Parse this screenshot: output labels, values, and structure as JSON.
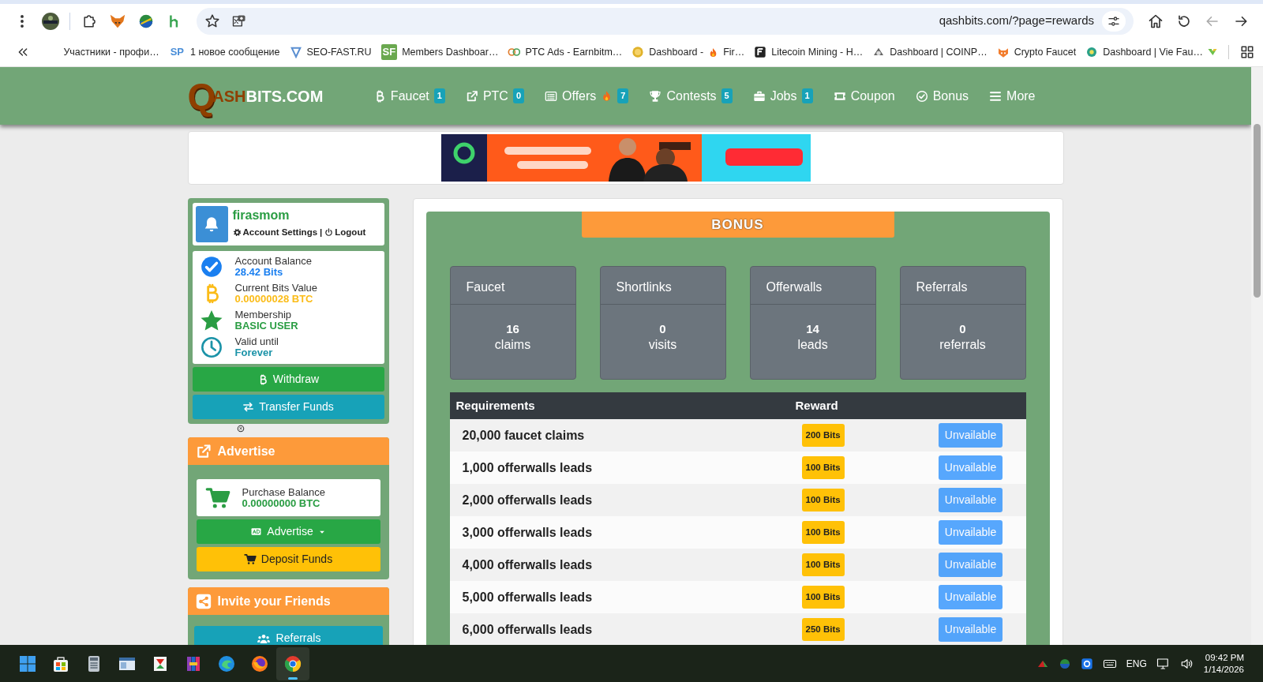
{
  "browser": {
    "address": "qashbits.com/?page=rewards",
    "bookmarks": [
      {
        "label": "Участники - профи…"
      },
      {
        "badge": "SP",
        "label": "1 новое сообщение"
      },
      {
        "label": "SEO-FAST.RU"
      },
      {
        "badge": "SF",
        "label": "Members Dashboar…"
      },
      {
        "label": "PTC Ads - Earnbitm…"
      },
      {
        "label": "Dashboard -",
        "label_after_fire": "Fir…"
      },
      {
        "label": "Litecoin Mining - H…"
      },
      {
        "label": "Dashboard | COINP…"
      },
      {
        "label": "Crypto Faucet"
      },
      {
        "label": "Dashboard | Vie Fau…"
      }
    ]
  },
  "site": {
    "logo": {
      "mark": "Q",
      "accent": "ASH",
      "rest": "BITS.COM"
    },
    "nav": [
      {
        "label": "Faucet",
        "count": "1",
        "hot": false
      },
      {
        "label": "PTC",
        "count": "0",
        "hot": false
      },
      {
        "label": "Offers",
        "count": "7",
        "hot": true
      },
      {
        "label": "Contests",
        "count": "5",
        "hot": false
      },
      {
        "label": "Jobs",
        "count": "1",
        "hot": false
      },
      {
        "label": "Coupon",
        "hot": false
      },
      {
        "label": "Bonus",
        "hot": false
      },
      {
        "label": "More",
        "hot": false
      }
    ]
  },
  "account": {
    "username": "firasmom",
    "links": [
      "Account Settings",
      "Logout"
    ],
    "separator": "|",
    "stats": [
      {
        "label": "Account Balance",
        "value": "28.42 Bits",
        "color": "#1a7ff0"
      },
      {
        "label": "Current Bits Value",
        "value": "0.00000028 BTC",
        "color": "#fbbc18"
      },
      {
        "label": "Membership",
        "value": "BASIC USER",
        "color": "#2a9d43"
      },
      {
        "label": "Valid until",
        "value": "Forever",
        "color": "#1b93a8"
      }
    ],
    "buttons": [
      "Withdraw",
      "Transfer Funds"
    ]
  },
  "advertise": {
    "title": "Advertise",
    "balance_label": "Purchase Balance",
    "balance_value": "0.00000000 BTC",
    "buttons": [
      "Advertise",
      "Deposit Funds"
    ]
  },
  "invite": {
    "title": "Invite your Friends",
    "buttons": [
      "Referrals"
    ]
  },
  "bonus": {
    "title": "BONUS",
    "cards": [
      {
        "title": "Faucet",
        "value": "16",
        "unit": "claims"
      },
      {
        "title": "Shortlinks",
        "value": "0",
        "unit": "visits"
      },
      {
        "title": "Offerwalls",
        "value": "14",
        "unit": "leads"
      },
      {
        "title": "Referrals",
        "value": "0",
        "unit": "referrals"
      }
    ],
    "table": {
      "columns": [
        "Requirements",
        "Reward"
      ],
      "rows": [
        {
          "requirement": "20,000 faucet claims",
          "reward": "200 Bits",
          "action": "Unvailable",
          "disabled": true
        },
        {
          "requirement": "1,000 offerwalls leads",
          "reward": "100 Bits",
          "action": "Unvailable",
          "disabled": true
        },
        {
          "requirement": "2,000 offerwalls leads",
          "reward": "100 Bits",
          "action": "Unvailable",
          "disabled": true
        },
        {
          "requirement": "3,000 offerwalls leads",
          "reward": "100 Bits",
          "action": "Unvailable",
          "disabled": true
        },
        {
          "requirement": "4,000 offerwalls leads",
          "reward": "100 Bits",
          "action": "Unvailable",
          "disabled": true
        },
        {
          "requirement": "5,000 offerwalls leads",
          "reward": "100 Bits",
          "action": "Unvailable",
          "disabled": true
        },
        {
          "requirement": "6,000 offerwalls leads",
          "reward": "250 Bits",
          "action": "Unvailable",
          "disabled": true
        }
      ]
    }
  },
  "taskbar": {
    "language": "ENG",
    "time": "09:42 PM",
    "date": "1/14/2026"
  }
}
